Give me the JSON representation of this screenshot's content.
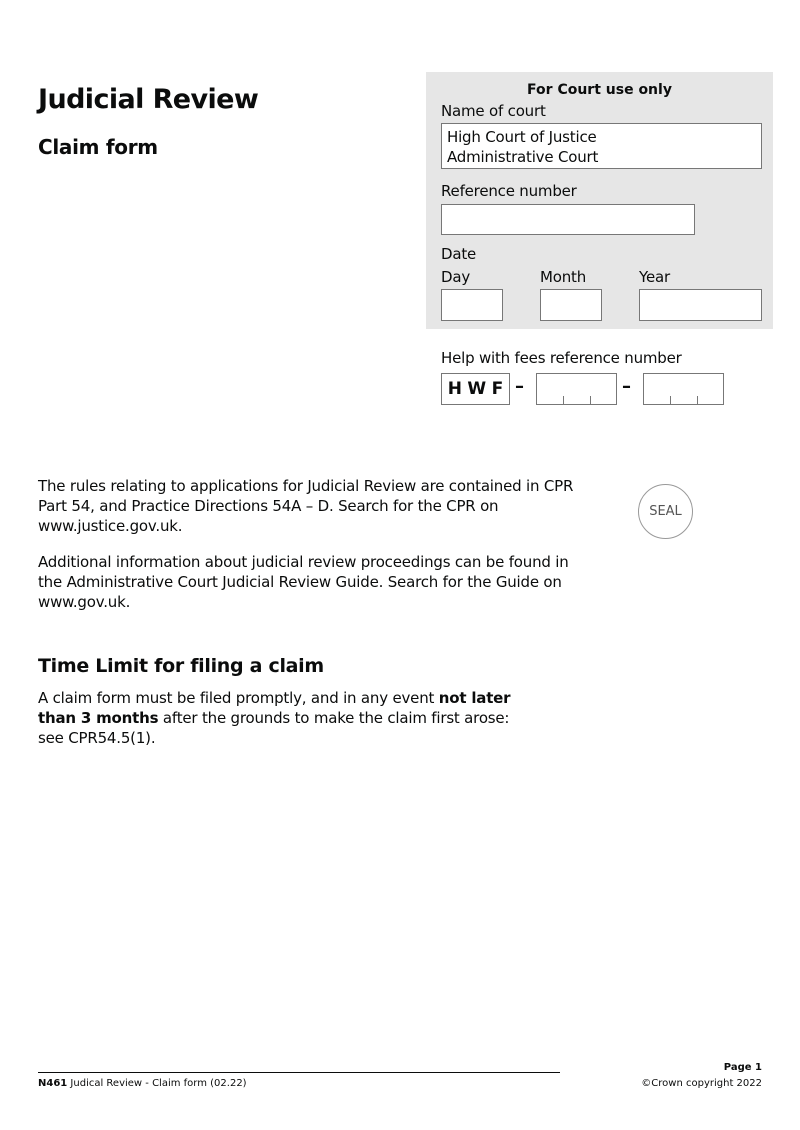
{
  "header": {
    "title": "Judicial Review",
    "subtitle": "Claim form"
  },
  "court_panel": {
    "heading": "For Court use only",
    "name_of_court_label": "Name of court",
    "name_of_court_lines": [
      "High Court of Justice",
      "Administrative Court"
    ],
    "reference_label": "Reference number",
    "reference_value": "",
    "date_label": "Date",
    "day_label": "Day",
    "month_label": "Month",
    "year_label": "Year",
    "day_value": "",
    "month_value": "",
    "year_value": ""
  },
  "hwf": {
    "label": "Help with fees reference number",
    "prefix_letters": [
      "H",
      "W",
      "F"
    ],
    "separator": "–",
    "segment1": [
      "",
      "",
      ""
    ],
    "segment2": [
      "",
      "",
      ""
    ]
  },
  "seal": {
    "label": "SEAL"
  },
  "body": {
    "para1": "The rules relating to applications for Judicial Review are contained in CPR Part 54, and Practice Directions 54A – D. Search for the CPR on www.justice.gov.uk.",
    "para2": "Additional information about judicial review proceedings can be found in the Administrative Court Judicial Review Guide. Search for the Guide on www.gov.uk.",
    "time_limit_heading": "Time Limit for filing a claim",
    "time_limit_text_1": "A claim form must be filed promptly, and in any event ",
    "time_limit_bold": "not later than 3 months",
    "time_limit_text_2": " after the grounds to make the claim first arose: see CPR54.5(1)."
  },
  "footer": {
    "form_code": "N461",
    "form_title": " Judical Review - Claim form (02.22)",
    "page": "Page 1",
    "copyright": "©Crown copyright 2022"
  }
}
